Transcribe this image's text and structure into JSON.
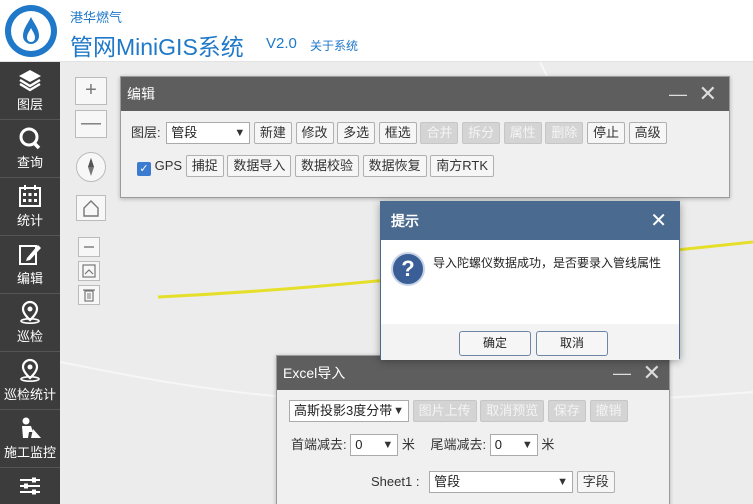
{
  "header": {
    "company": "港华燃气",
    "app_title": "管网MiniGIS系统",
    "version": "V2.0",
    "about": "关于系统"
  },
  "sidebar": {
    "items": [
      {
        "label": "图层",
        "icon": "layers-icon"
      },
      {
        "label": "查询",
        "icon": "search-icon"
      },
      {
        "label": "统计",
        "icon": "calendar-icon"
      },
      {
        "label": "编辑",
        "icon": "edit-icon"
      },
      {
        "label": "巡检",
        "icon": "location-icon"
      },
      {
        "label": "巡检统计",
        "icon": "location-stats-icon"
      },
      {
        "label": "施工监控",
        "icon": "worker-icon"
      },
      {
        "label": "",
        "icon": "sliders-icon"
      }
    ]
  },
  "map_tools": {
    "zoom_in": "+",
    "zoom_out": "—"
  },
  "edit_panel": {
    "title": "编辑",
    "layer_label": "图层:",
    "layer_value": "管段",
    "row1_buttons": [
      {
        "label": "新建",
        "enabled": true
      },
      {
        "label": "修改",
        "enabled": true
      },
      {
        "label": "多选",
        "enabled": true
      },
      {
        "label": "框选",
        "enabled": true
      },
      {
        "label": "合并",
        "enabled": false
      },
      {
        "label": "拆分",
        "enabled": false
      },
      {
        "label": "属性",
        "enabled": false
      },
      {
        "label": "删除",
        "enabled": false
      },
      {
        "label": "停止",
        "enabled": true
      },
      {
        "label": "高级",
        "enabled": true
      }
    ],
    "gps_label": "GPS",
    "gps_checked": true,
    "row2_buttons": [
      {
        "label": "捕捉"
      },
      {
        "label": "数据导入"
      },
      {
        "label": "数据校验"
      },
      {
        "label": "数据恢复"
      },
      {
        "label": "南方RTK"
      }
    ]
  },
  "dialog": {
    "title": "提示",
    "message": "导入陀螺仪数据成功，是否要录入管线属性",
    "ok_label": "确定",
    "cancel_label": "取消"
  },
  "excel_panel": {
    "title": "Excel导入",
    "projection_value": "高斯投影3度分带",
    "buttons": [
      {
        "label": "图片上传",
        "enabled": false
      },
      {
        "label": "取消预览",
        "enabled": false
      },
      {
        "label": "保存",
        "enabled": false
      },
      {
        "label": "撤销",
        "enabled": false
      }
    ],
    "start_label": "首端减去:",
    "start_value": "0",
    "end_label": "尾端减去:",
    "end_value": "0",
    "unit": "米",
    "sheet_label": "Sheet1 :",
    "sheet_value": "管段",
    "field_button": "字段"
  },
  "colors": {
    "brand": "#1f78c8",
    "sidebar": "#3c3c3c",
    "panel_header": "#5e5e5e",
    "dialog_header": "#4a6a8f",
    "road_line": "#e5df2a"
  }
}
